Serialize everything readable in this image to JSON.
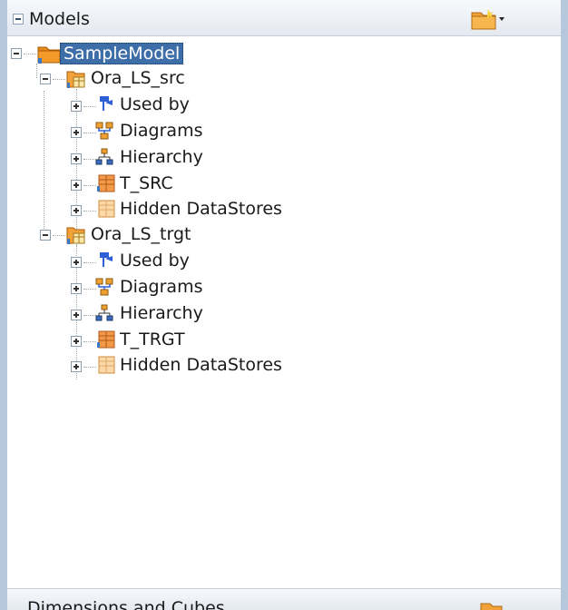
{
  "panel": {
    "title": "Models",
    "footer_title": "Dimensions and Cubes"
  },
  "tree": {
    "root": {
      "label": "SampleModel",
      "selected": true,
      "icon": "model-folder-icon"
    },
    "children": [
      {
        "label": "Ora_LS_src",
        "icon": "logical-schema-icon",
        "items": [
          {
            "label": "Used by",
            "icon": "used-by-icon"
          },
          {
            "label": "Diagrams",
            "icon": "diagrams-icon"
          },
          {
            "label": "Hierarchy",
            "icon": "hierarchy-icon"
          },
          {
            "label": "T_SRC",
            "icon": "datastore-icon"
          },
          {
            "label": "Hidden DataStores",
            "icon": "hidden-datastore-icon"
          }
        ]
      },
      {
        "label": "Ora_LS_trgt",
        "icon": "logical-schema-icon",
        "items": [
          {
            "label": "Used by",
            "icon": "used-by-icon"
          },
          {
            "label": "Diagrams",
            "icon": "diagrams-icon"
          },
          {
            "label": "Hierarchy",
            "icon": "hierarchy-icon"
          },
          {
            "label": "T_TRGT",
            "icon": "datastore-icon"
          },
          {
            "label": "Hidden DataStores",
            "icon": "hidden-datastore-icon"
          }
        ]
      }
    ]
  },
  "colors": {
    "selection": "#3e6ea8",
    "folder": "#f29a2e",
    "frame": "#b8c8dc"
  }
}
